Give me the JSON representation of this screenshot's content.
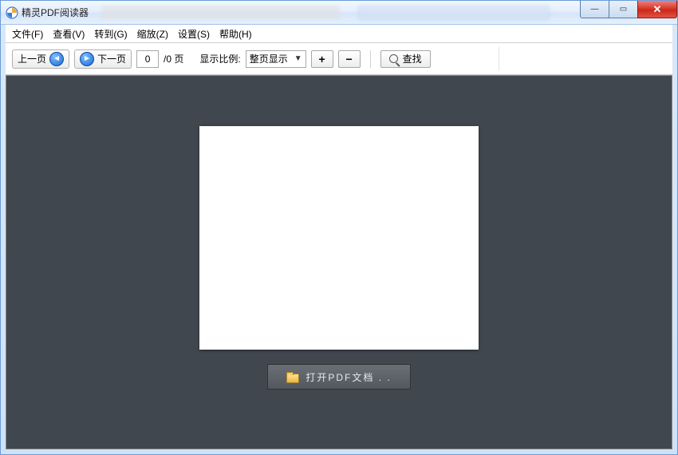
{
  "app": {
    "title": "精灵PDF阅读器"
  },
  "menu": {
    "file": "文件(F)",
    "view": "查看(V)",
    "goto": "转到(G)",
    "zoom": "缩放(Z)",
    "settings": "设置(S)",
    "help": "帮助(H)"
  },
  "toolbar": {
    "prev": "上一页",
    "next": "下一页",
    "page_value": "0",
    "page_total": "/0 页",
    "zoom_label": "显示比例:",
    "zoom_mode": "整页显示",
    "zoom_in": "+",
    "zoom_out": "−",
    "search": "查找"
  },
  "main": {
    "open_label": "打开PDF文档 . ."
  },
  "win": {
    "min": "—",
    "max": "▭",
    "close": "✕"
  }
}
